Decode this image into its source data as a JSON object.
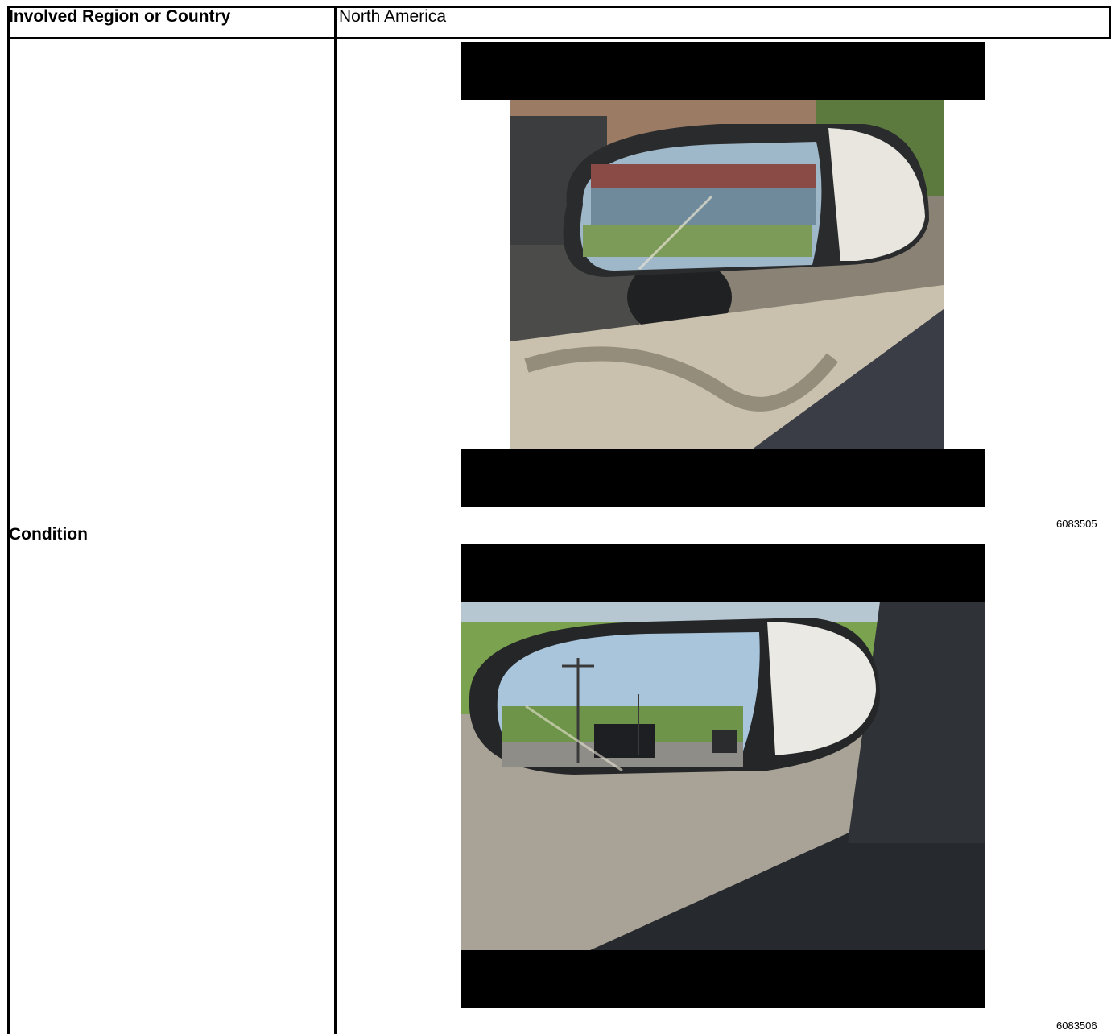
{
  "table": {
    "row1": {
      "label": "Involved Region or Country",
      "value": "North America"
    },
    "row2": {
      "label": "Condition",
      "figures": [
        {
          "id": "6083505",
          "subject": "driver side mirror, parked"
        },
        {
          "id": "6083506",
          "subject": "driver side mirror, driving"
        }
      ]
    }
  }
}
